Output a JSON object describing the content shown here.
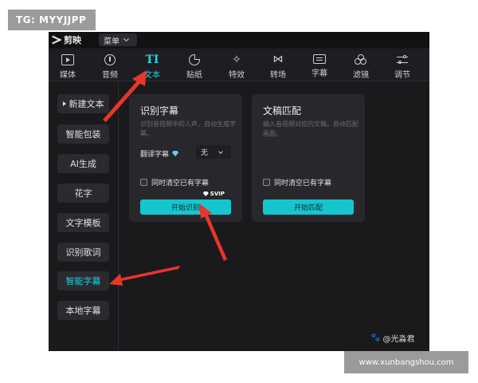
{
  "watermark_top": "TG: MYYJJPP",
  "watermark_bottom": "www.xunbangshou.com",
  "watermark_author": "@光淼君",
  "app": {
    "logo_text": "剪映",
    "menu_label": "菜单"
  },
  "toolbar": {
    "items": [
      {
        "label": "媒体",
        "icon": "media-icon"
      },
      {
        "label": "音频",
        "icon": "audio-icon"
      },
      {
        "label": "文本",
        "icon": "text-icon",
        "glyph": "TI",
        "active": true
      },
      {
        "label": "贴纸",
        "icon": "sticker-icon"
      },
      {
        "label": "特效",
        "icon": "effects-icon"
      },
      {
        "label": "转场",
        "icon": "transition-icon"
      },
      {
        "label": "字幕",
        "icon": "subtitle-icon"
      },
      {
        "label": "滤镜",
        "icon": "filter-icon"
      },
      {
        "label": "调节",
        "icon": "adjust-icon"
      }
    ]
  },
  "sidebar": {
    "items": [
      {
        "label": "新建文本"
      },
      {
        "label": "智能包装"
      },
      {
        "label": "AI生成"
      },
      {
        "label": "花字"
      },
      {
        "label": "文字模板"
      },
      {
        "label": "识别歌词"
      },
      {
        "label": "智能字幕",
        "active": true
      },
      {
        "label": "本地字幕"
      }
    ]
  },
  "cards": {
    "recognize": {
      "title": "识别字幕",
      "description": "识别音视频中的人声，自动生成字幕。",
      "translate_label": "翻译字幕",
      "translate_value": "无",
      "clear_label": "同时清空已有字幕",
      "badge": "SVIP",
      "button": "开始识别"
    },
    "match": {
      "title": "文稿匹配",
      "description": "输入音视频对应的文稿，自动匹配画面。",
      "clear_label": "同时清空已有字幕",
      "button": "开始匹配"
    }
  },
  "colors": {
    "accent": "#22d3dc",
    "button": "#16c6cf",
    "annotation_arrow": "#e8362a"
  }
}
